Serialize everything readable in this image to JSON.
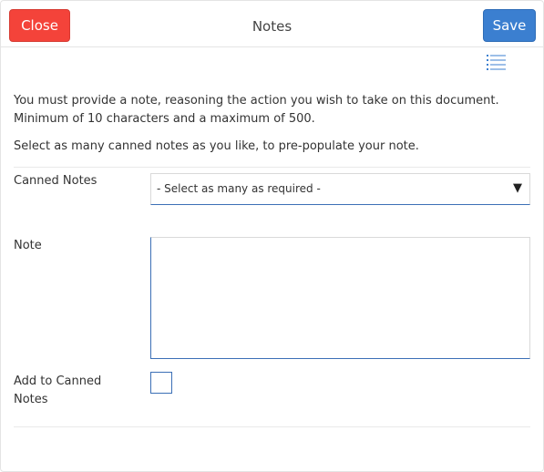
{
  "header": {
    "title": "Notes",
    "close_label": "Close",
    "save_label": "Save",
    "close_color": "#f4433a",
    "save_color": "#3b7fd0"
  },
  "toolbar": {
    "list_icon": "list-icon"
  },
  "instructions": {
    "line1": "You must provide a note, reasoning the action you wish to take on this document.",
    "line2": "Minimum of 10 characters and a maximum of 500.",
    "line3": "Select as many canned notes as you like, to pre-populate your note."
  },
  "form": {
    "canned_notes": {
      "label": "Canned Notes",
      "selected_value": "- Select as many as required -",
      "caret_icon": "caret-down-icon"
    },
    "note": {
      "label": "Note",
      "value": "",
      "placeholder": ""
    },
    "add_to_canned": {
      "label_line1": "Add to Canned",
      "label_line2": "Notes",
      "checked": false
    }
  }
}
